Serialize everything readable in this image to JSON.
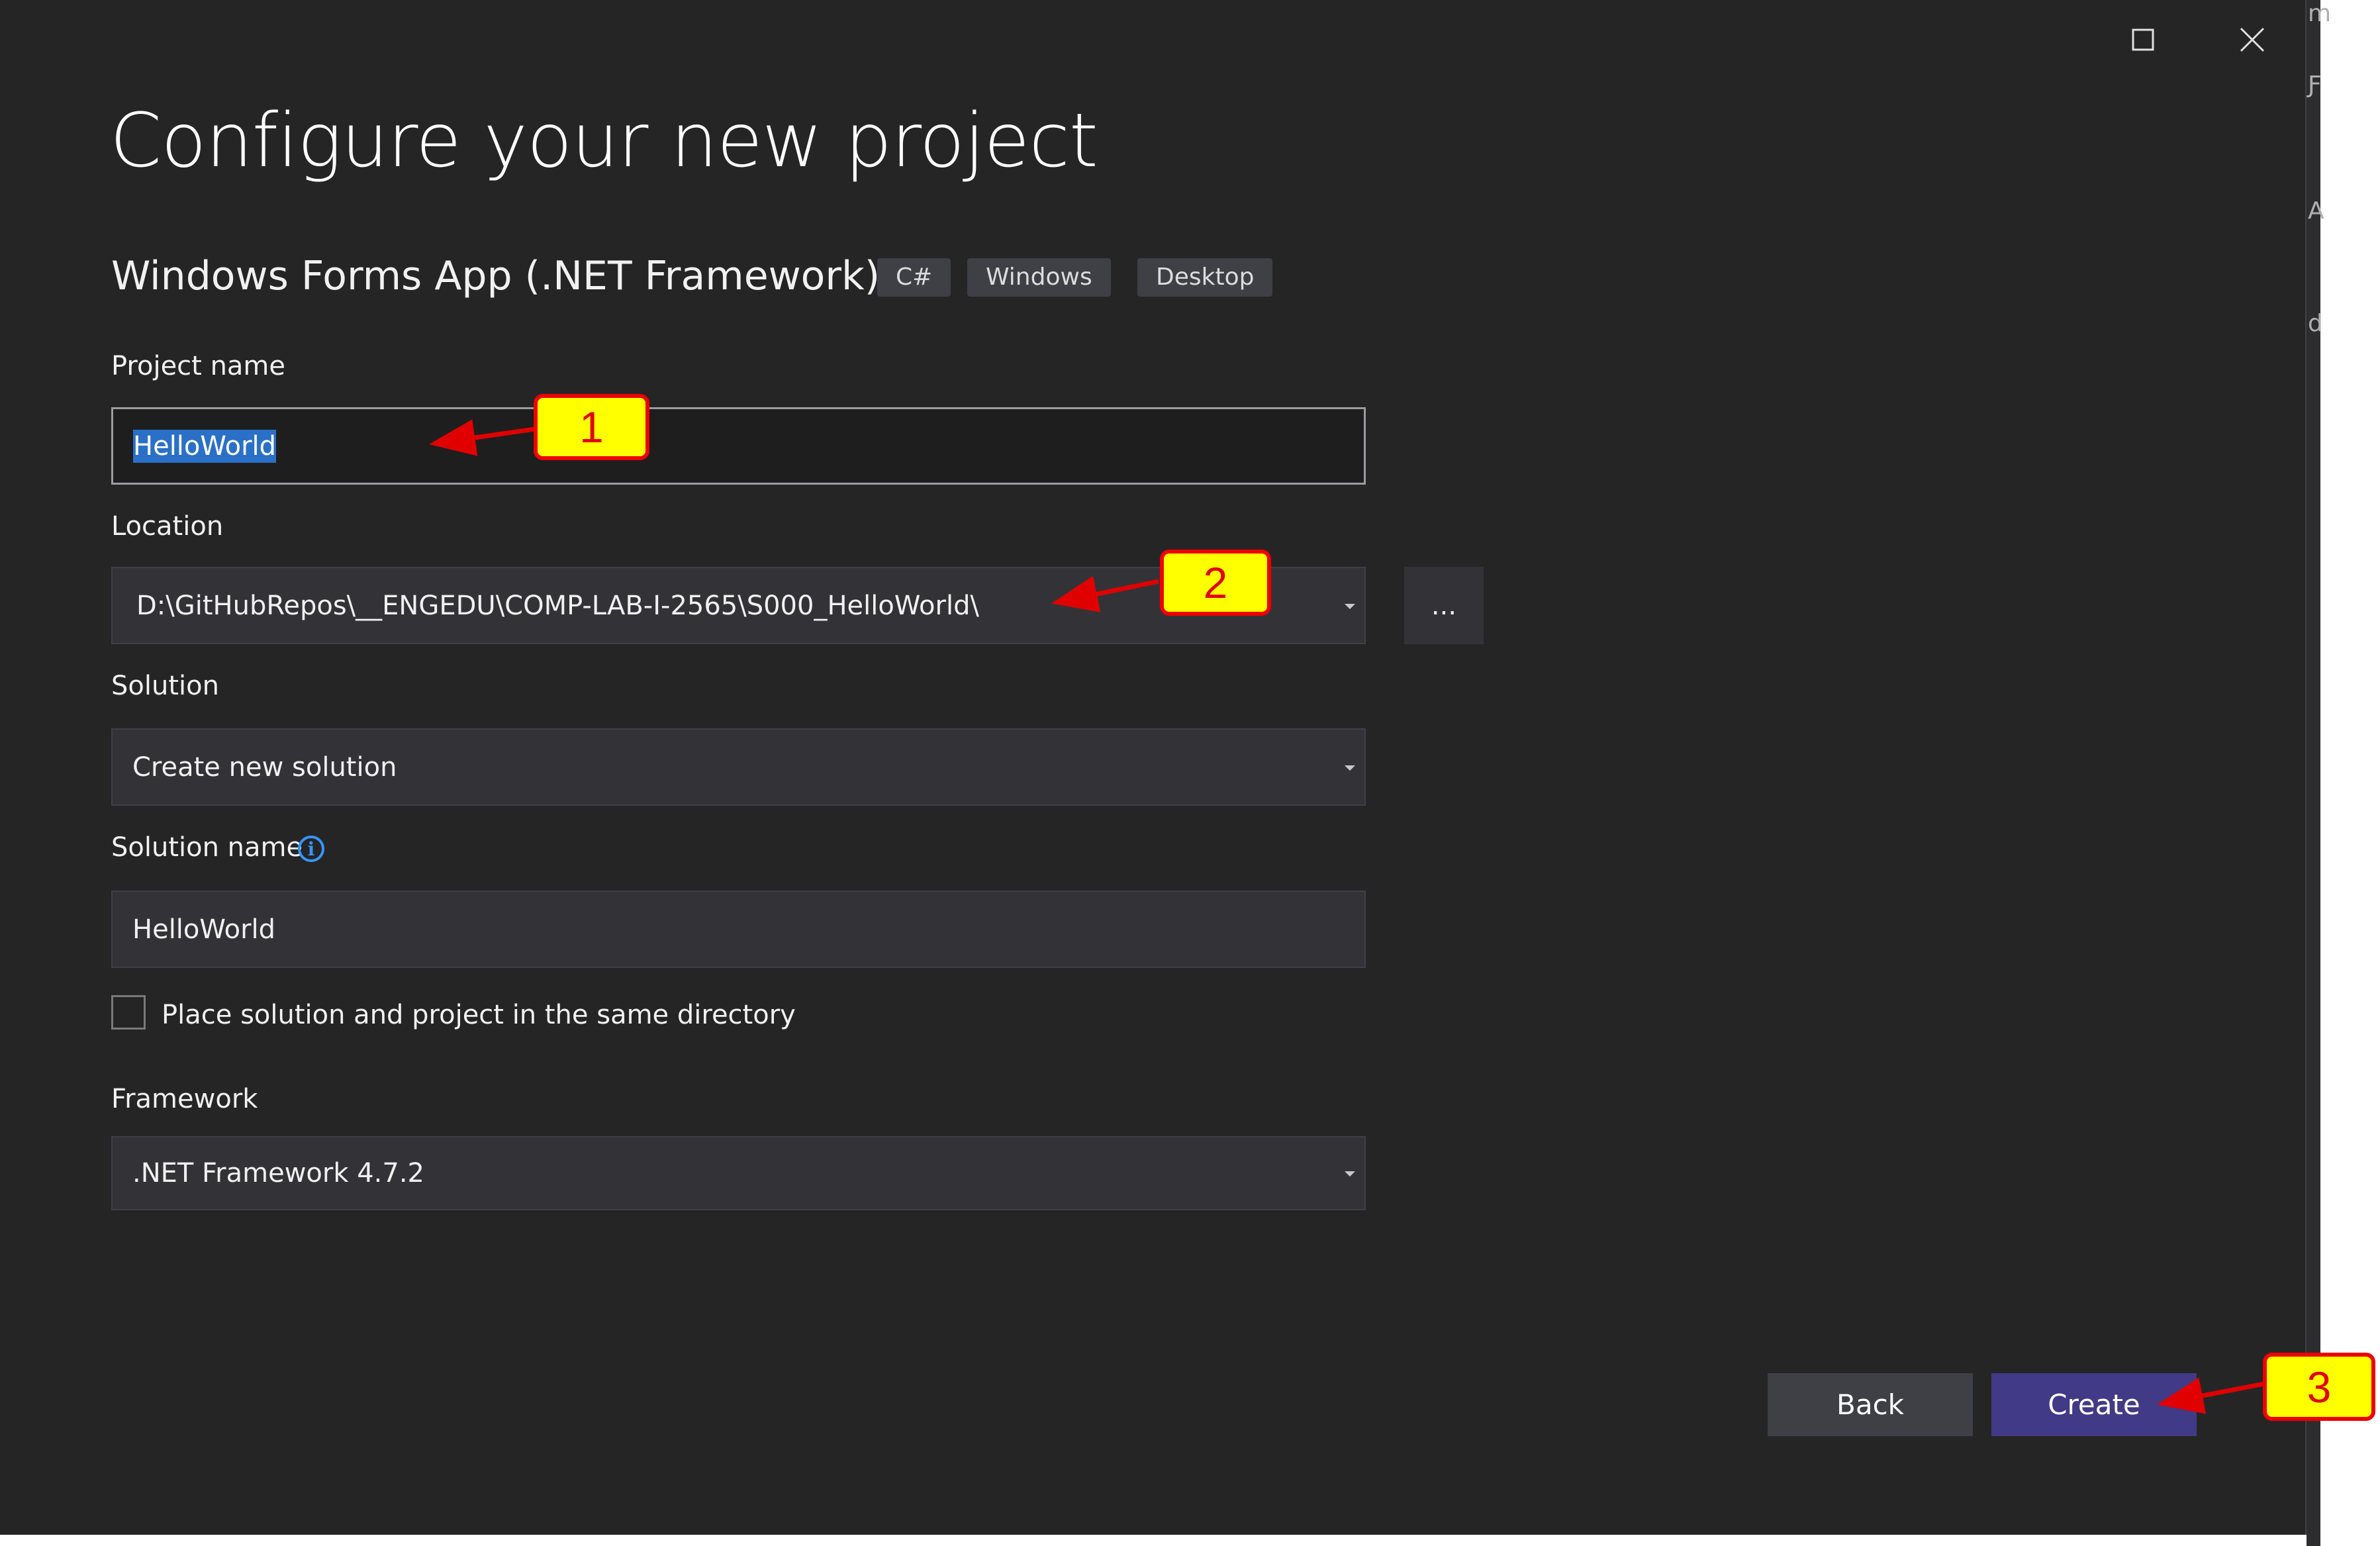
{
  "header": {
    "title": "Configure your new project",
    "template_name": "Windows Forms App (.NET Framework)",
    "tags": [
      "C#",
      "Windows",
      "Desktop"
    ]
  },
  "window_controls": {
    "maximize_icon": "maximize-icon",
    "close_icon": "close-icon"
  },
  "background_strip_chars": [
    "m",
    "Ƒ",
    "A",
    "d"
  ],
  "form": {
    "project_name_label": "Project name",
    "project_name_value": "HelloWorld",
    "location_label": "Location",
    "location_value": "D:\\GitHubRepos\\__ENGEDU\\COMP-LAB-I-2565\\S000_HelloWorld\\",
    "browse_label": "...",
    "solution_label": "Solution",
    "solution_value": "Create new solution",
    "solution_name_label": "Solution name",
    "solution_name_value": "HelloWorld",
    "same_dir_label": "Place solution and project in the same directory",
    "same_dir_checked": false,
    "framework_label": "Framework",
    "framework_value": ".NET Framework 4.7.2"
  },
  "buttons": {
    "back": "Back",
    "create": "Create"
  },
  "callouts": [
    "1",
    "2",
    "3"
  ],
  "colors": {
    "background": "#252526",
    "accent": "#413a86",
    "callout_fill": "#ffff00",
    "callout_border": "#ee0000"
  }
}
